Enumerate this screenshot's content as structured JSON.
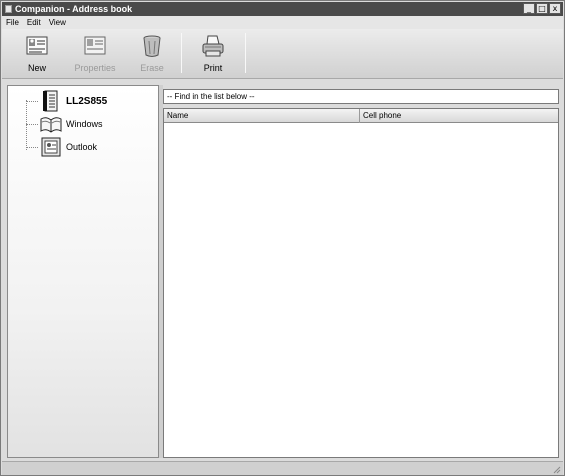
{
  "window": {
    "title": "Companion - Address book",
    "controls": [
      "_",
      "□",
      "x"
    ]
  },
  "menu": {
    "items": [
      "File",
      "Edit",
      "View"
    ]
  },
  "toolbar": {
    "buttons": [
      {
        "label": "New",
        "icon": "new-contact-icon",
        "enabled": true
      },
      {
        "label": "Properties",
        "icon": "properties-icon",
        "enabled": false
      },
      {
        "label": "Erase",
        "icon": "trash-icon",
        "enabled": false
      },
      {
        "label": "Print",
        "icon": "printer-icon",
        "enabled": true
      }
    ]
  },
  "tree": {
    "nodes": [
      {
        "label": "LL2S855",
        "icon": "phone-book-icon",
        "selected": true
      },
      {
        "label": "Windows",
        "icon": "open-book-icon",
        "selected": false
      },
      {
        "label": "Outlook",
        "icon": "outlook-contacts-icon",
        "selected": false
      }
    ]
  },
  "search": {
    "value": "-- Find in the list below --"
  },
  "list": {
    "columns": [
      "Name",
      "Cell phone"
    ],
    "rows": []
  }
}
